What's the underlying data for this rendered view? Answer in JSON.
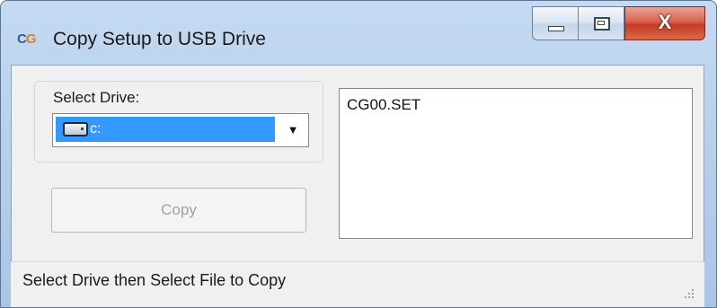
{
  "window": {
    "icon_text_c": "C",
    "icon_text_g": "G",
    "title": "Copy Setup to USB Drive",
    "controls": {
      "minimize": "minimize",
      "maximize": "maximize",
      "close": "X"
    }
  },
  "drive": {
    "label": "Select Drive:",
    "selected": "c:",
    "drive_icon": "hard-drive-icon",
    "dropdown_arrow": "▼"
  },
  "copy_button": {
    "label": "Copy",
    "enabled": false
  },
  "file_list": {
    "items": [
      "CG00.SET"
    ]
  },
  "status": {
    "text": "Select Drive then Select File to Copy"
  },
  "colors": {
    "selection": "#3399ff",
    "client_bg": "#f0f0f0",
    "close_button": "#c63b22",
    "icon_blue": "#2f5f9c",
    "icon_orange": "#e07f1f"
  }
}
